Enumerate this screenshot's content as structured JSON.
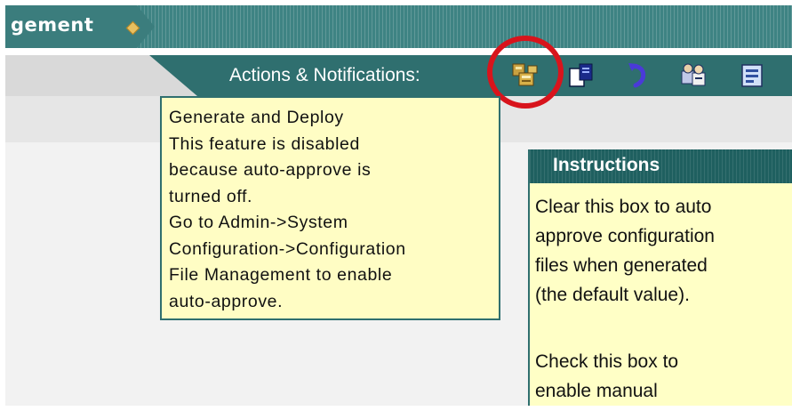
{
  "header": {
    "title": "gement",
    "title_icon": "diamond-icon"
  },
  "actions": {
    "label": "Actions & Notifications:",
    "icons": [
      {
        "name": "generate-deploy-icon",
        "highlighted": true
      },
      {
        "name": "document-export-icon"
      },
      {
        "name": "refresh-icon"
      },
      {
        "name": "users-config-icon"
      },
      {
        "name": "report-icon"
      }
    ],
    "highlight_color": "#d8141c"
  },
  "tooltip": {
    "lines": [
      "Generate and Deploy",
      "This feature is disabled",
      "because auto-approve is",
      "turned off.",
      "Go to Admin->System",
      "Configuration->Configuration",
      "File Management to enable",
      "auto-approve."
    ],
    "background": "#fffdc4"
  },
  "instructions": {
    "title": "Instructions",
    "para1": [
      "Clear this box to auto",
      "approve configuration",
      "files when generated",
      "(the default value)."
    ],
    "para2": [
      "Check this box to",
      "enable manual"
    ]
  },
  "colors": {
    "teal_dark": "#2f6f6f",
    "teal_light": "#3e8383",
    "panel_yellow": "#ffffc6"
  }
}
